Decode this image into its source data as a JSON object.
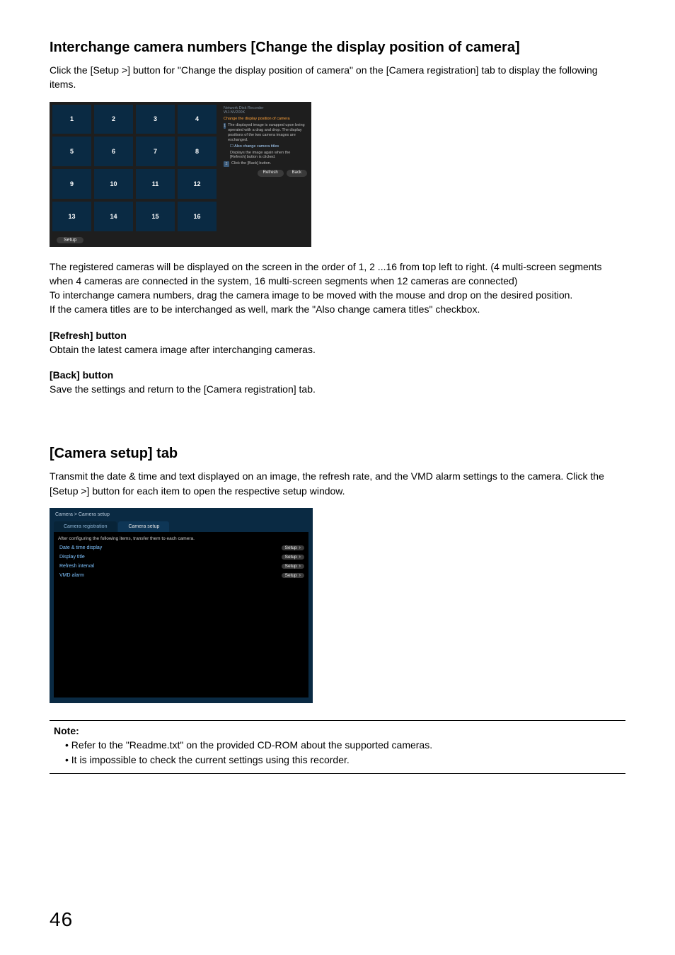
{
  "section1": {
    "heading": "Interchange camera numbers [Change the display position of camera]",
    "intro": "Click the [Setup >] button for \"Change the display position of camera\" on the [Camera registration] tab to display the following items.",
    "para2": "The registered cameras will be displayed on the screen in the order of 1, 2 ...16 from top left to right. (4 multi-screen segments when 4 cameras are connected in the system, 16 multi-screen segments when 12 cameras are connected)\nTo interchange camera numbers, drag the camera image to be moved with the mouse and drop on the desired position.\nIf the camera titles are to be interchanged as well, mark the \"Also change camera titles\" checkbox.",
    "refresh_label": "[Refresh] button",
    "refresh_text": "Obtain the latest camera image after interchanging cameras.",
    "back_label": "[Back] button",
    "back_text": "Save the settings and return to the [Camera registration] tab."
  },
  "shot1": {
    "tiles": [
      "1",
      "2",
      "3",
      "4",
      "5",
      "6",
      "7",
      "8",
      "9",
      "10",
      "11",
      "12",
      "13",
      "14",
      "15",
      "16"
    ],
    "setup_btn": "Setup",
    "panel_head1": "Network Disk Recorder",
    "panel_head2": "WJ-NV200K",
    "panel_title": "Change the display position of camera",
    "step1_num": "1",
    "step1_text": "The displayed image is swapped upon being operated with a drag and drop. The display positions of the two camera images are exchanged.",
    "check1": "Also change camera titles",
    "step1b": "Displays the image again when the [Refresh] button is clicked.",
    "step2_num": "2",
    "step2_text": "Click the [Back] button.",
    "btn_refresh": "Refresh",
    "btn_back": "Back"
  },
  "section2": {
    "heading": "[Camera setup] tab",
    "intro": "Transmit the date & time and text displayed on an image, the refresh rate, and the VMD alarm settings to the camera. Click the [Setup >] button for each item to open the respective setup window."
  },
  "shot2": {
    "crumbs": "Camera > Camera setup",
    "tab1": "Camera registration",
    "tab2": "Camera setup",
    "intro": "After configuring the following items, transfer them to each camera.",
    "rows": [
      {
        "label": "Date & time display",
        "btn": "Setup"
      },
      {
        "label": "Display title",
        "btn": "Setup"
      },
      {
        "label": "Refresh interval",
        "btn": "Setup"
      },
      {
        "label": "VMD alarm",
        "btn": "Setup"
      }
    ]
  },
  "note": {
    "title": "Note:",
    "items": [
      "Refer to the \"Readme.txt\" on the provided CD-ROM about the supported cameras.",
      "It is impossible to check the current settings using this recorder."
    ]
  },
  "page_number": "46"
}
